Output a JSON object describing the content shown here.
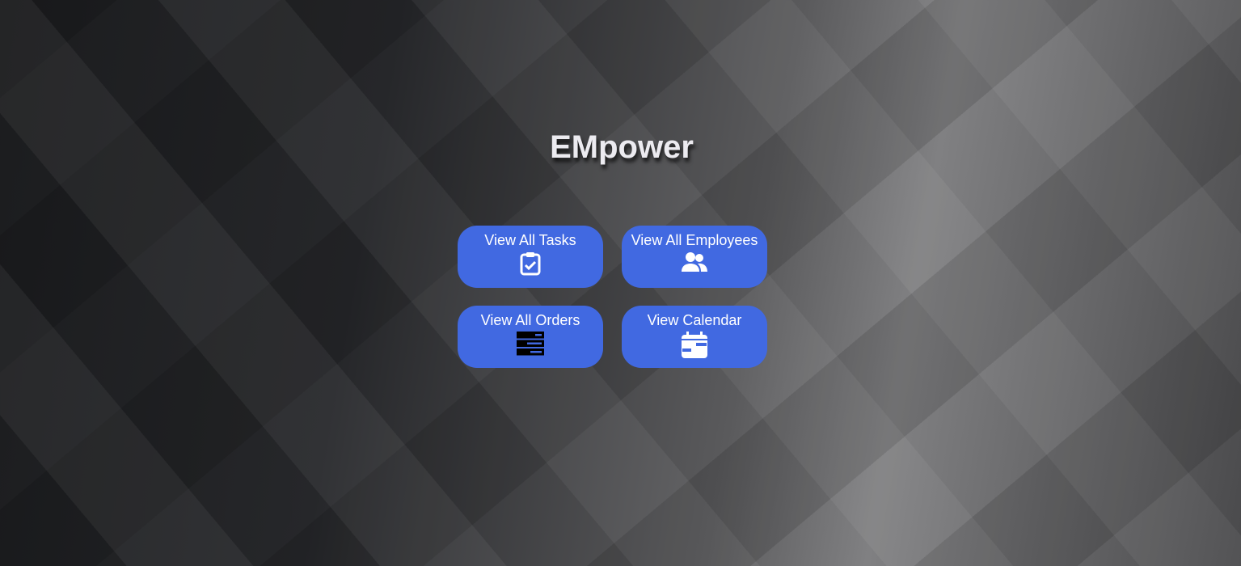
{
  "header": {
    "title": "EMpower"
  },
  "buttons": [
    {
      "label": "View All Tasks",
      "icon": "clipboard-check-icon"
    },
    {
      "label": "View All Employees",
      "icon": "users-icon"
    },
    {
      "label": "View All Orders",
      "icon": "server-icon"
    },
    {
      "label": "View Calendar",
      "icon": "calendar-icon"
    }
  ],
  "colors": {
    "button": "#4169e1",
    "title": "#ecebf0"
  }
}
